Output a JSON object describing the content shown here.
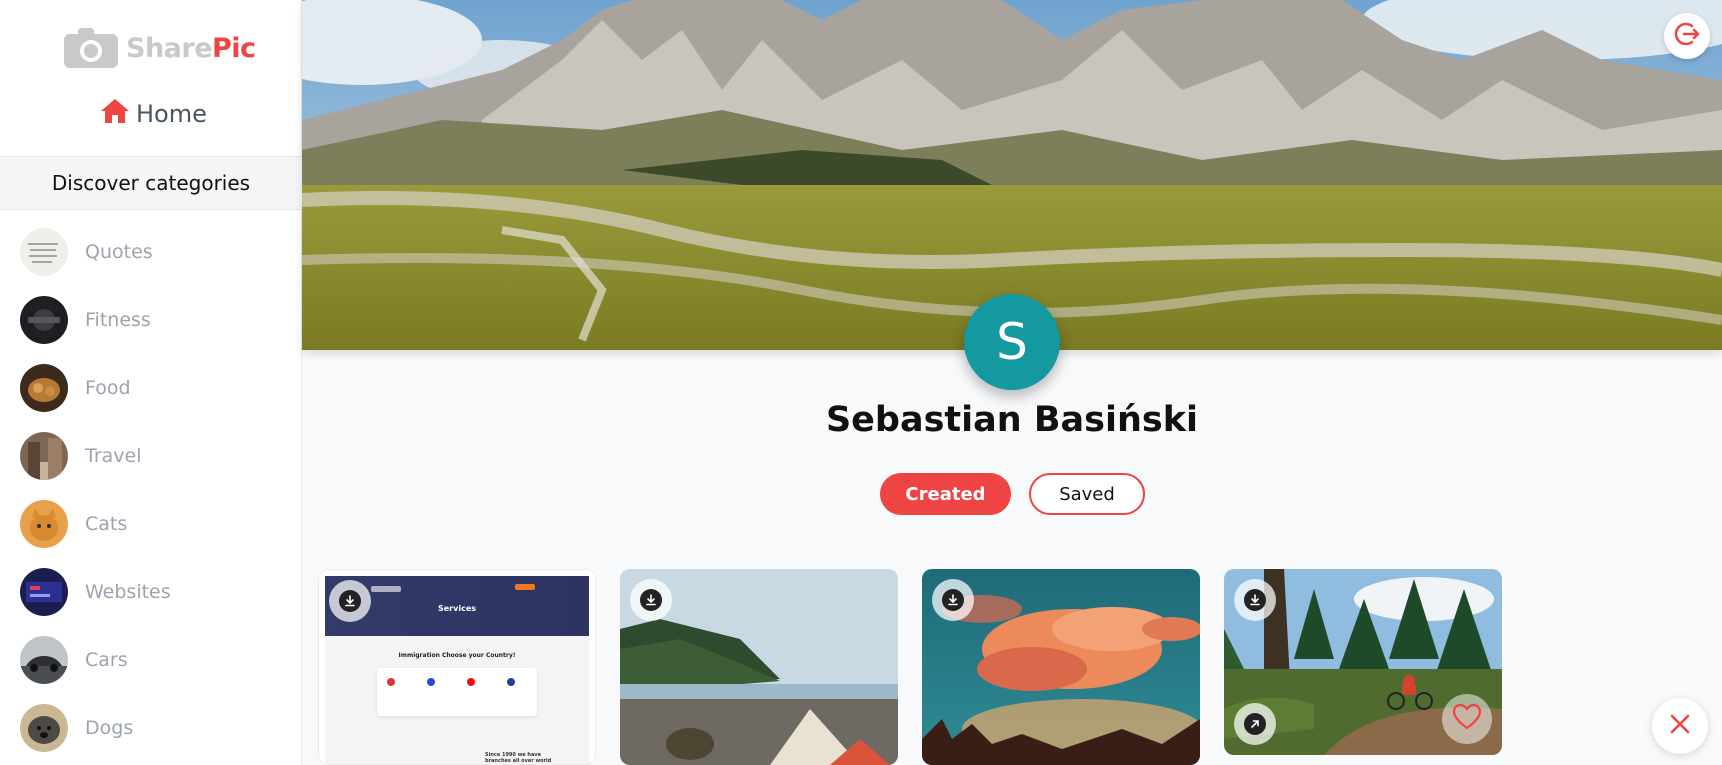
{
  "app": {
    "name_part1": "Share",
    "name_part2": "Pic",
    "brand_color": "#ef4444",
    "logo_icon": "camera-icon"
  },
  "sidebar": {
    "home_label": "Home",
    "home_icon": "home-icon",
    "categories_title": "Discover categories",
    "categories": [
      {
        "label": "Quotes"
      },
      {
        "label": "Fitness"
      },
      {
        "label": "Food"
      },
      {
        "label": "Travel"
      },
      {
        "label": "Cats"
      },
      {
        "label": "Websites"
      },
      {
        "label": "Cars"
      },
      {
        "label": "Dogs"
      }
    ]
  },
  "profile": {
    "avatar_initial": "S",
    "avatar_color": "#1499a1",
    "name": "Sebastian Basiński",
    "tabs": {
      "created": "Created",
      "saved": "Saved"
    }
  },
  "pins": [
    {
      "subject": "website-screenshot",
      "mock_title": "Services",
      "mock_subtitle": "Immigration Choose your Country!",
      "mock_footer": "Since 1990 we have branches all over world"
    },
    {
      "subject": "beach-tent"
    },
    {
      "subject": "sunset-clouds"
    },
    {
      "subject": "forest-biker"
    }
  ]
}
